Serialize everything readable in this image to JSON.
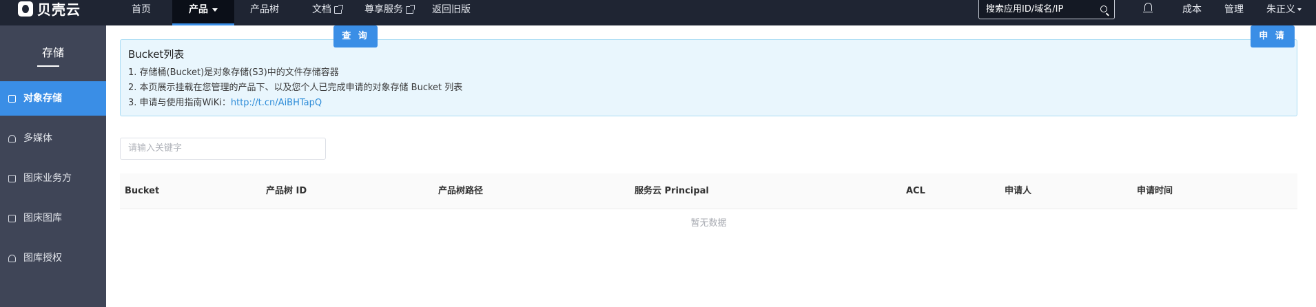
{
  "header": {
    "brand": "贝壳云",
    "nav": [
      {
        "label": "首页"
      },
      {
        "label": "产品"
      },
      {
        "label": "产品树"
      },
      {
        "label": "文档"
      },
      {
        "label": "尊享服务"
      },
      {
        "label": "返回旧版"
      }
    ],
    "search_placeholder": "搜索应用ID/域名/IP",
    "right": {
      "cost": "成本",
      "manage": "管理",
      "user": "朱正义"
    }
  },
  "sidebar": {
    "title": "存储",
    "items": [
      {
        "label": "对象存储",
        "icon": "grid-icon"
      },
      {
        "label": "多媒体",
        "icon": "headphones-icon"
      },
      {
        "label": "图床业务方",
        "icon": "image-icon"
      },
      {
        "label": "图床图库",
        "icon": "doc-icon"
      },
      {
        "label": "图库授权",
        "icon": "badge-icon"
      }
    ]
  },
  "main": {
    "notice": {
      "title": "Bucket列表",
      "line1": "1. 存储桶(Bucket)是对象存储(S3)中的文件存储容器",
      "line2": "2. 本页展示挂载在您管理的产品下、以及您个人已完成申请的对象存储 Bucket 列表",
      "line3_prefix": "3. 申请与使用指南WiKi：",
      "line3_link": "http://t.cn/AiBHTapQ"
    },
    "keyword_placeholder": "请输入关键字",
    "query_label": "查 询",
    "apply_label": "申 请",
    "table": {
      "columns": [
        "Bucket",
        "产品树 ID",
        "产品树路径",
        "服务云 Principal",
        "ACL",
        "申请人",
        "申请时间"
      ],
      "empty_text": "暂无数据"
    }
  },
  "colors": {
    "accent": "#3a8ee6",
    "topbar": "#1f2533",
    "sidebar": "#3f4557"
  }
}
